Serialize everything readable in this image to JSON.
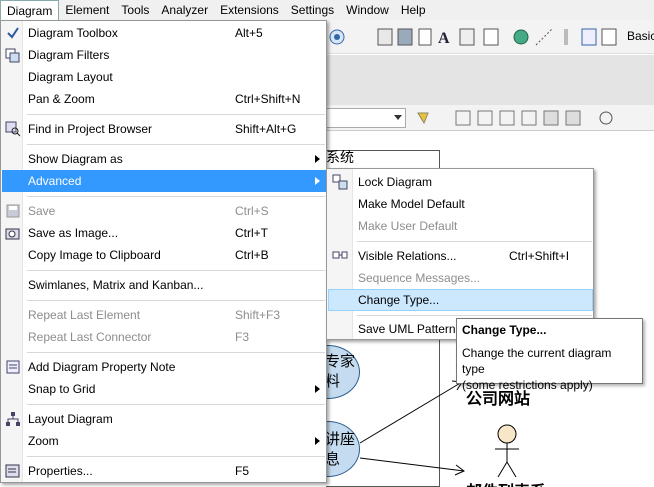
{
  "menubar": {
    "items": [
      "Diagram",
      "Element",
      "Tools",
      "Analyzer",
      "Extensions",
      "Settings",
      "Window",
      "Help"
    ]
  },
  "toolbar": {
    "perspective_label": "Basic"
  },
  "canvas": {
    "frame_title": "系统",
    "ellipse1_text": "专家\n料",
    "ellipse2_text": "讲座\n息",
    "actor1_label": "公司网站",
    "actor2_label": "邮件列表系"
  },
  "diagram_menu": {
    "items": [
      {
        "label": "Diagram Toolbox",
        "shortcut": "Alt+5",
        "icon": "check-icon"
      },
      {
        "label": "Diagram Filters",
        "shortcut": "",
        "icon": "filter-icon"
      },
      {
        "label": "Diagram Layout",
        "shortcut": ""
      },
      {
        "label": "Pan & Zoom",
        "shortcut": "Ctrl+Shift+N"
      },
      {
        "label": "Find in Project Browser",
        "shortcut": "Shift+Alt+G",
        "icon": "find-icon"
      },
      {
        "label": "Show Diagram as",
        "shortcut": "",
        "submenu": true
      },
      {
        "label": "Advanced",
        "shortcut": "",
        "submenu": true,
        "highlighted": true
      },
      {
        "label": "Save",
        "shortcut": "Ctrl+S",
        "disabled": true,
        "icon": "save-icon"
      },
      {
        "label": "Save as Image...",
        "shortcut": "Ctrl+T",
        "icon": "camera-icon"
      },
      {
        "label": "Copy Image to Clipboard",
        "shortcut": "Ctrl+B"
      },
      {
        "label": "Swimlanes, Matrix and Kanban...",
        "shortcut": ""
      },
      {
        "label": "Repeat Last Element",
        "shortcut": "Shift+F3",
        "disabled": true
      },
      {
        "label": "Repeat Last Connector",
        "shortcut": "F3",
        "disabled": true
      },
      {
        "label": "Add Diagram Property Note",
        "shortcut": "",
        "icon": "note-icon"
      },
      {
        "label": "Snap to Grid",
        "shortcut": "",
        "submenu": true
      },
      {
        "label": "Layout Diagram",
        "shortcut": "",
        "icon": "layout-icon"
      },
      {
        "label": "Zoom",
        "shortcut": "",
        "submenu": true
      },
      {
        "label": "Properties...",
        "shortcut": "F5",
        "icon": "properties-icon"
      }
    ]
  },
  "advanced_menu": {
    "items": [
      {
        "label": "Lock Diagram",
        "shortcut": "",
        "icon": "lock-diagram-icon"
      },
      {
        "label": "Make Model Default",
        "shortcut": ""
      },
      {
        "label": "Make User Default",
        "shortcut": "",
        "disabled": true
      },
      {
        "label": "Visible Relations...",
        "shortcut": "Ctrl+Shift+I",
        "icon": "relations-icon"
      },
      {
        "label": "Sequence Messages...",
        "shortcut": "",
        "disabled": true
      },
      {
        "label": "Change Type...",
        "shortcut": "",
        "selected": true
      },
      {
        "label": "Save UML Pattern...",
        "shortcut": ""
      }
    ]
  },
  "tooltip": {
    "title": "Change Type...",
    "body_line1": "Change the current diagram type",
    "body_line2": "(some restrictions apply)"
  },
  "colors": {
    "highlight": "#3399ff",
    "selected_bg": "#cce8ff",
    "ellipse_fill": "#c5dcf0"
  }
}
